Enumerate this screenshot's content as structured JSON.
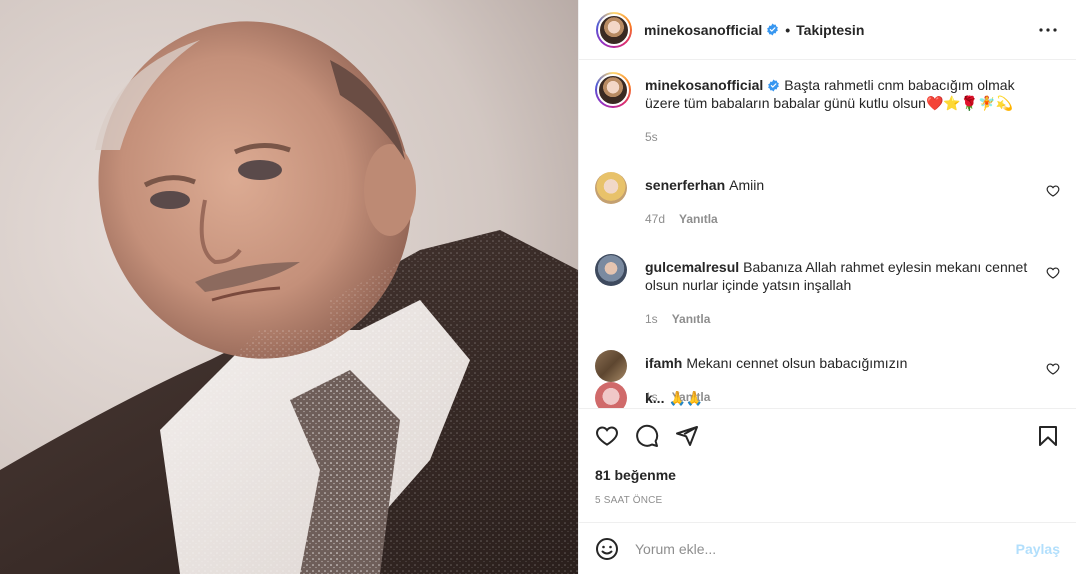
{
  "post": {
    "username": "minekosanofficial",
    "follow_label": "Takiptesin",
    "more_label": "•••",
    "caption": "Başta rahmetli cnm babacığım olmak üzere tüm babaların babalar günü kutlu olsun❤️⭐🌹🧚💫",
    "caption_time": "5s"
  },
  "comments": [
    {
      "user": "senerferhan",
      "text": "Amiin",
      "time": "47d",
      "reply": "Yanıtla"
    },
    {
      "user": "gulcemalresul",
      "text": "Babanıza Allah rahmet eylesin mekanı cennet olsun nurlar içinde yatsın inşallah",
      "time": "1s",
      "reply": "Yanıtla"
    },
    {
      "user": "ifamh",
      "text": "Mekanı cennet olsun babacığımızın",
      "time": "1s",
      "reply": "Yanıtla"
    }
  ],
  "partial_comment": {
    "user": "k...",
    "text": "🙏🙏"
  },
  "stats": {
    "likes": "81 beğenme",
    "posted": "5 SAAT ÖNCE"
  },
  "composer": {
    "placeholder": "Yorum ekle...",
    "submit_label": "Paylaş"
  },
  "colors": {
    "accent": "#0095f6",
    "submit_disabled": "#b2dffc",
    "muted": "#8e8e8e",
    "verified": "#3897f0"
  },
  "icons": {
    "like": "heart-outline-icon",
    "comment": "comment-bubble-icon",
    "share": "paper-plane-icon",
    "save": "bookmark-icon",
    "emoji": "smiley-icon",
    "more": "more-dots-icon",
    "verified": "verified-badge-icon"
  }
}
